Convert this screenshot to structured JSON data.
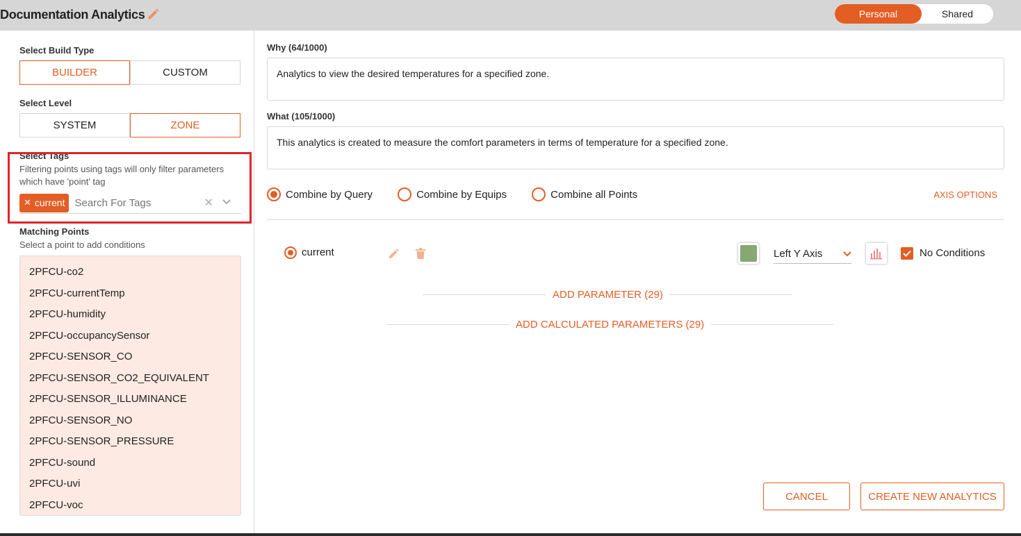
{
  "header": {
    "title": "Documentation Analytics",
    "toggle": {
      "personal": "Personal",
      "shared": "Shared",
      "active": "personal"
    }
  },
  "left": {
    "build_type": {
      "label": "Select Build Type",
      "options": [
        "BUILDER",
        "CUSTOM"
      ],
      "selected": "BUILDER"
    },
    "level": {
      "label": "Select Level",
      "options": [
        "SYSTEM",
        "ZONE"
      ],
      "selected": "ZONE"
    },
    "tags": {
      "label": "Select Tags",
      "help_line1": "Filtering points using tags will only filter parameters",
      "help_line2": "which have 'point' tag",
      "chips": [
        "current"
      ],
      "placeholder": "Search For Tags"
    },
    "matching": {
      "label": "Matching Points",
      "help": "Select a point to add conditions",
      "points": [
        "2PFCU-co2",
        "2PFCU-currentTemp",
        "2PFCU-humidity",
        "2PFCU-occupancySensor",
        "2PFCU-SENSOR_CO",
        "2PFCU-SENSOR_CO2_EQUIVALENT",
        "2PFCU-SENSOR_ILLUMINANCE",
        "2PFCU-SENSOR_NO",
        "2PFCU-SENSOR_PRESSURE",
        "2PFCU-sound",
        "2PFCU-uvi",
        "2PFCU-voc"
      ]
    }
  },
  "right": {
    "why": {
      "label": "Why (64/1000)",
      "value": "Analytics to view the desired temperatures for a specified zone."
    },
    "what": {
      "label": "What (105/1000)",
      "value": "This analytics is created to measure the comfort parameters in terms of temperature for a specified zone."
    },
    "combine": {
      "options": [
        "Combine by Query",
        "Combine by Equips",
        "Combine all Points"
      ],
      "selected": "Combine by Query"
    },
    "axis_options": "AXIS OPTIONS",
    "parameter": {
      "name": "current",
      "color": "#86a873",
      "axis": "Left Y Axis",
      "no_conditions": "No Conditions"
    },
    "add_parameter": "ADD PARAMETER (29)",
    "add_calculated": "ADD CALCULATED PARAMETERS (29)",
    "cancel": "CANCEL",
    "create": "CREATE NEW ANALYTICS"
  },
  "colors": {
    "accent": "#e35d25",
    "highlight": "#e0232b",
    "list_bg": "#fdeae2"
  }
}
